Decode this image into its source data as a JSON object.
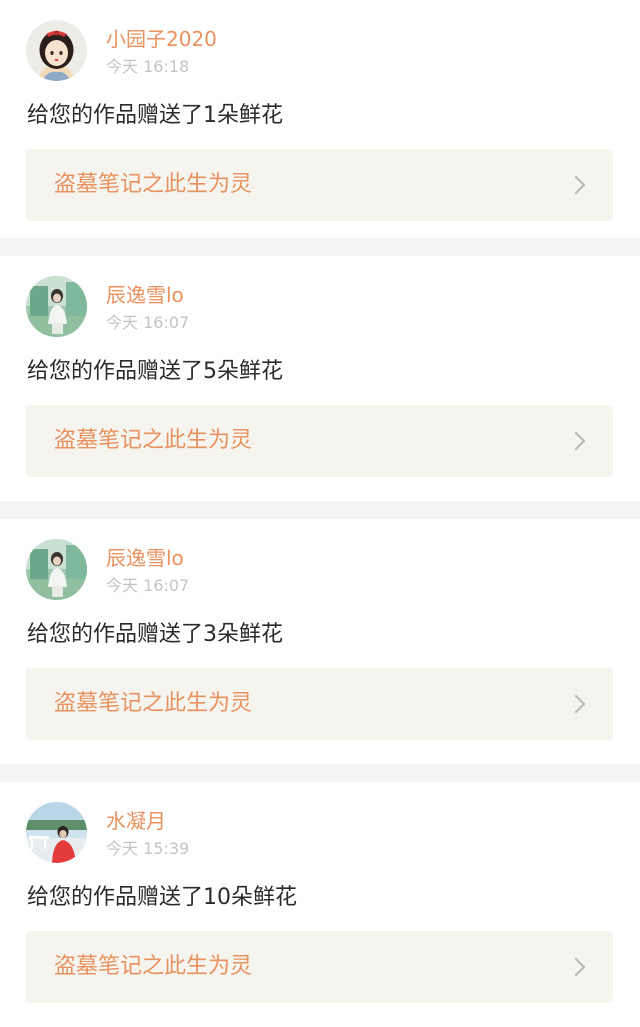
{
  "notifications": [
    {
      "username": "小园子2020",
      "time": "今天 16:18",
      "message": "给您的作品赠送了1朵鲜花",
      "work_title": "盗墓笔记之此生为灵",
      "avatar": "avatar-girl-red-bow"
    },
    {
      "username": "辰逸雪lo",
      "time": "今天 16:07",
      "message": "给您的作品赠送了5朵鲜花",
      "work_title": "盗墓笔记之此生为灵",
      "avatar": "avatar-photo-green"
    },
    {
      "username": "辰逸雪lo",
      "time": "今天 16:07",
      "message": "给您的作品赠送了3朵鲜花",
      "work_title": "盗墓笔记之此生为灵",
      "avatar": "avatar-photo-green"
    },
    {
      "username": "水凝月",
      "time": "今天 15:39",
      "message": "给您的作品赠送了10朵鲜花",
      "work_title": "盗墓笔记之此生为灵",
      "avatar": "avatar-photo-red"
    }
  ],
  "colors": {
    "accent": "#e8925f",
    "text": "#2b2b2b",
    "muted": "#c4c4c4",
    "link_bg": "#f5f4ee",
    "separator": "#f5f4f4"
  }
}
